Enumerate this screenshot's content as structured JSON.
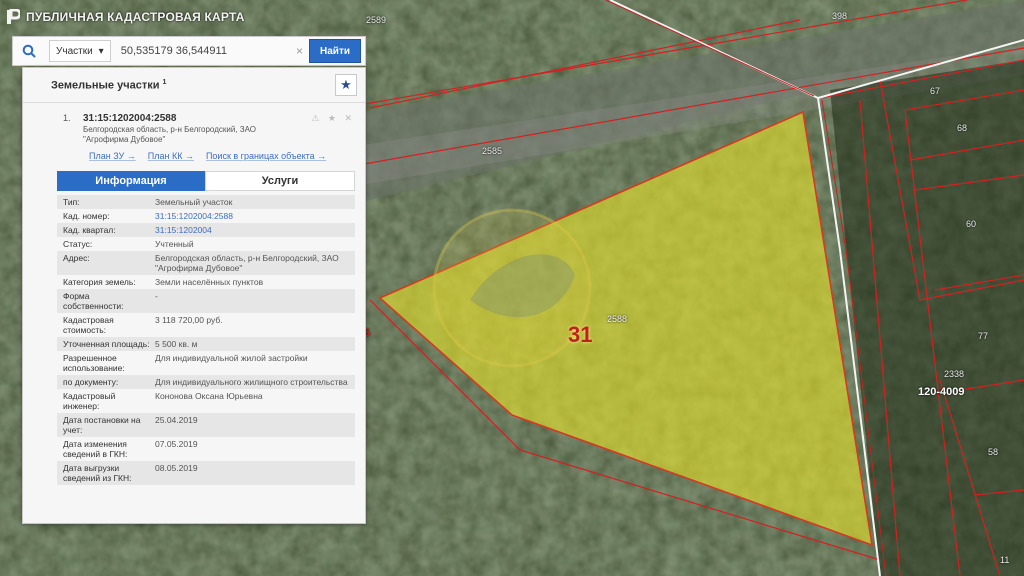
{
  "app": {
    "title": "ПУБЛИЧНАЯ КАДАСТРОВАЯ КАРТА"
  },
  "search": {
    "type_label": "Участки",
    "value": "50,535179 36,544911",
    "clear_label": "×",
    "button_label": "Найти"
  },
  "panel": {
    "title": "Земельные участки",
    "title_count": "1",
    "favorite_icon": "star-icon",
    "result": {
      "number": "1.",
      "cadastral_number": "31:15:1202004:2588",
      "address_line1": "Белгородская область, р-н Белгородский, ЗАО",
      "address_line2": "\"Агрофирма Дубовое\"",
      "tools": "⚠ ★ ✕"
    },
    "links": {
      "plan_zu": "План ЗУ →",
      "plan_kk": "План КК →",
      "search_bounds": "Поиск в границах объекта →"
    },
    "tabs": {
      "info": "Информация",
      "services": "Услуги"
    },
    "rows": [
      {
        "k": "Тип:",
        "v": "Земельный участок"
      },
      {
        "k": "Кад. номер:",
        "v": "31:15:1202004:2588"
      },
      {
        "k": "Кад. квартал:",
        "v": "31:15:1202004"
      },
      {
        "k": "Статус:",
        "v": "Учтенный"
      },
      {
        "k": "Адрес:",
        "v": "Белгородская область, р-н Белгородский, ЗАО \"Агрофирма Дубовое\""
      },
      {
        "k": "Категория земель:",
        "v": "Земли населённых пунктов"
      },
      {
        "k": "Форма собственности:",
        "v": "-"
      },
      {
        "k": "Кадастровая стоимость:",
        "v": "3 118 720,00 руб."
      },
      {
        "k": "Уточненная площадь:",
        "v": "5 500 кв. м"
      },
      {
        "k": "Разрешенное использование:",
        "v": "Для индивидуальной жилой застройки"
      },
      {
        "k": "по документу:",
        "v": "Для индивидуального жилищного строительства"
      },
      {
        "k": "Кадастровый инженер:",
        "v": "Кононова Оксана Юрьевна"
      },
      {
        "k": "Дата постановки на учет:",
        "v": "25.04.2019"
      },
      {
        "k": "Дата изменения сведений в ГКН:",
        "v": "07.05.2019"
      },
      {
        "k": "Дата выгрузки сведений из ГКН:",
        "v": "08.05.2019"
      }
    ]
  },
  "map": {
    "labels": {
      "l2589": "2589",
      "l398": "398",
      "l2585": "2585",
      "l67": "67",
      "l68": "68",
      "l60": "60",
      "l77": "77",
      "l2338": "2338",
      "l120": "120-4009",
      "l58": "58",
      "l11": "11",
      "l5": "5",
      "l31": "31",
      "l2588": "2588"
    }
  }
}
